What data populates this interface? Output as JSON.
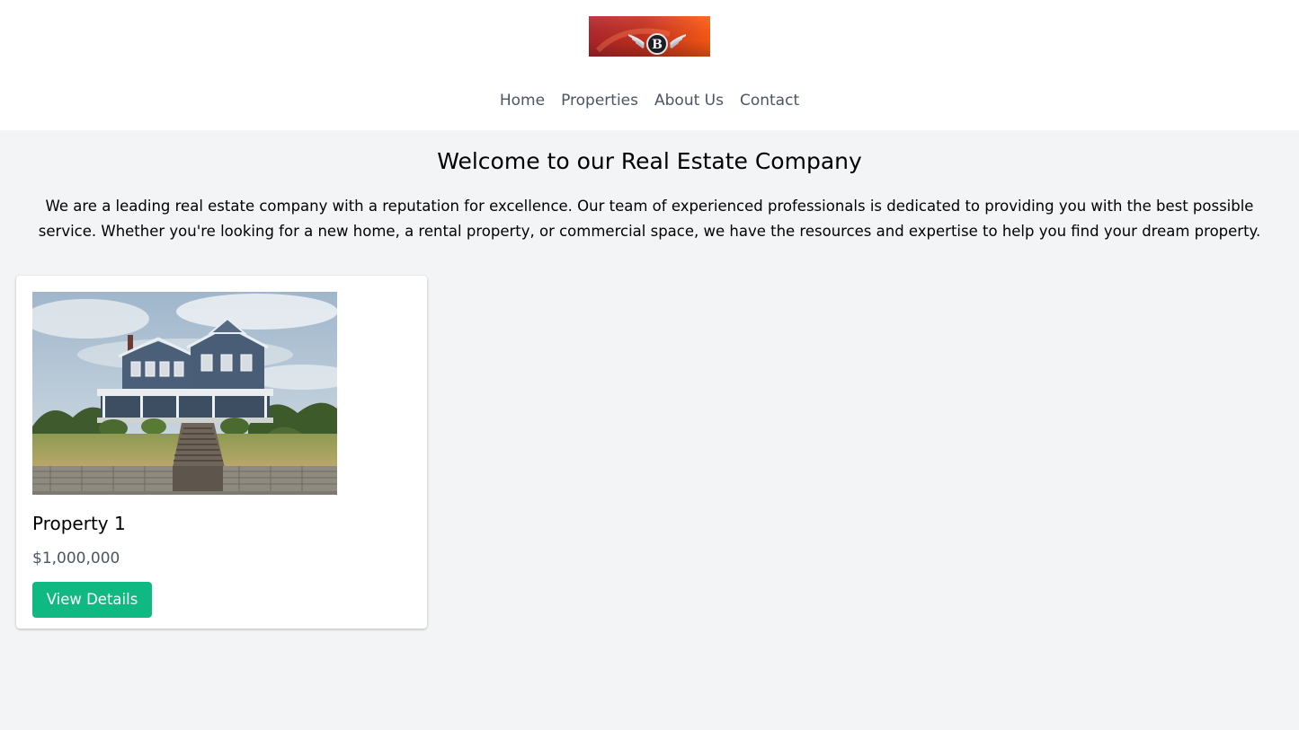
{
  "header": {
    "logo_icon": "winged-b-emblem-logo",
    "nav": [
      {
        "label": "Home"
      },
      {
        "label": "Properties"
      },
      {
        "label": "About Us"
      },
      {
        "label": "Contact"
      }
    ]
  },
  "hero": {
    "title": "Welcome to our Real Estate Company",
    "description": "We are a leading real estate company with a reputation for excellence. Our team of experienced professionals is dedicated to providing you with the best possible service. Whether you're looking for a new home, a rental property, or commercial space, we have the resources and expertise to help you find your dream property."
  },
  "listings": [
    {
      "image_icon": "victorian-house-photo",
      "title": "Property 1",
      "price": "$1,000,000",
      "button_label": "View Details"
    }
  ],
  "colors": {
    "page_background": "#f3f4f6",
    "nav_text": "#4b5563",
    "price_text": "#4b5563",
    "button_background": "#10b981",
    "button_text": "#ffffff"
  }
}
